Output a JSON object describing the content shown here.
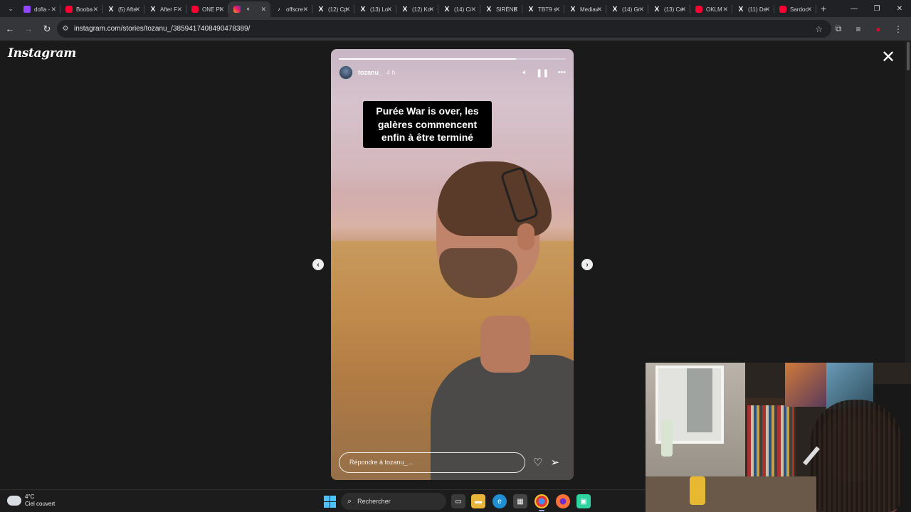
{
  "browser": {
    "tabs": [
      {
        "label": "dofla -",
        "favicon": "twitch-icon"
      },
      {
        "label": "Booba",
        "favicon": "youtube-icon"
      },
      {
        "label": "(5) Afte",
        "favicon": "x-icon"
      },
      {
        "label": "After F",
        "favicon": "x-icon"
      },
      {
        "label": "ONE PI",
        "favicon": "youtube-icon"
      },
      {
        "label": "",
        "favicon": "instagram-icon",
        "active": true
      },
      {
        "label": "offscre",
        "favicon": "tiktok-icon"
      },
      {
        "label": "(12) Cp",
        "favicon": "x-icon"
      },
      {
        "label": "(13) Lo",
        "favicon": "x-icon"
      },
      {
        "label": "(12) Ko",
        "favicon": "x-icon"
      },
      {
        "label": "(14) Ci",
        "favicon": "x-icon"
      },
      {
        "label": "SIRÈNE",
        "favicon": "x-icon"
      },
      {
        "label": "TBT9 s",
        "favicon": "x-icon"
      },
      {
        "label": "Mediav",
        "favicon": "x-icon"
      },
      {
        "label": "(14) Gr",
        "favicon": "x-icon"
      },
      {
        "label": "(13) Ce",
        "favicon": "x-icon"
      },
      {
        "label": "OKLM",
        "favicon": "youtube-icon"
      },
      {
        "label": "(11) De",
        "favicon": "x-icon"
      },
      {
        "label": "Sardoc",
        "favicon": "youtube-icon"
      }
    ],
    "url": "instagram.com/stories/tozanu_/3859417408490478389/"
  },
  "instagram": {
    "logo": "Instagram",
    "story": {
      "username": "tozanu_",
      "time": "4 h",
      "progress": 0.78,
      "caption_lines": [
        "Purée War is over, les",
        "galères commencent",
        "enfin à être terminé"
      ],
      "reply_placeholder": "Répondre à tozanu_..."
    }
  },
  "taskbar": {
    "weather_temp": "4°C",
    "weather_desc": "Ciel couvert",
    "search_label": "Rechercher"
  },
  "colors": {
    "accent": "#4cc2ff",
    "youtube": "#ff0033",
    "background": "#1a1a1a"
  }
}
